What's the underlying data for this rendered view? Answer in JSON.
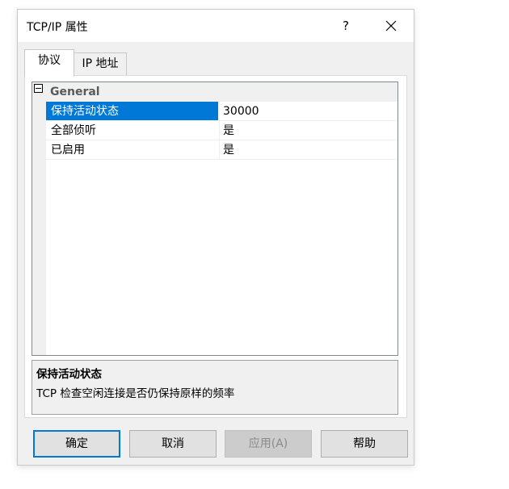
{
  "window": {
    "title": "TCP/IP 属性",
    "help_symbol": "?"
  },
  "tabs": [
    {
      "label": "协议",
      "active": true
    },
    {
      "label": "IP 地址",
      "active": false
    }
  ],
  "property_grid": {
    "category": "General",
    "rows": [
      {
        "name": "保持活动状态",
        "value": "30000",
        "selected": true
      },
      {
        "name": "全部侦听",
        "value": "是",
        "selected": false
      },
      {
        "name": "已启用",
        "value": "是",
        "selected": false
      }
    ]
  },
  "description": {
    "title": "保持活动状态",
    "text": "TCP 检查空闲连接是否仍保持原样的频率"
  },
  "buttons": {
    "ok": "确定",
    "cancel": "取消",
    "apply": "应用(A)",
    "help": "帮助"
  },
  "colors": {
    "selection": "#0078d7",
    "dialog_bg": "#f0f0f0"
  }
}
